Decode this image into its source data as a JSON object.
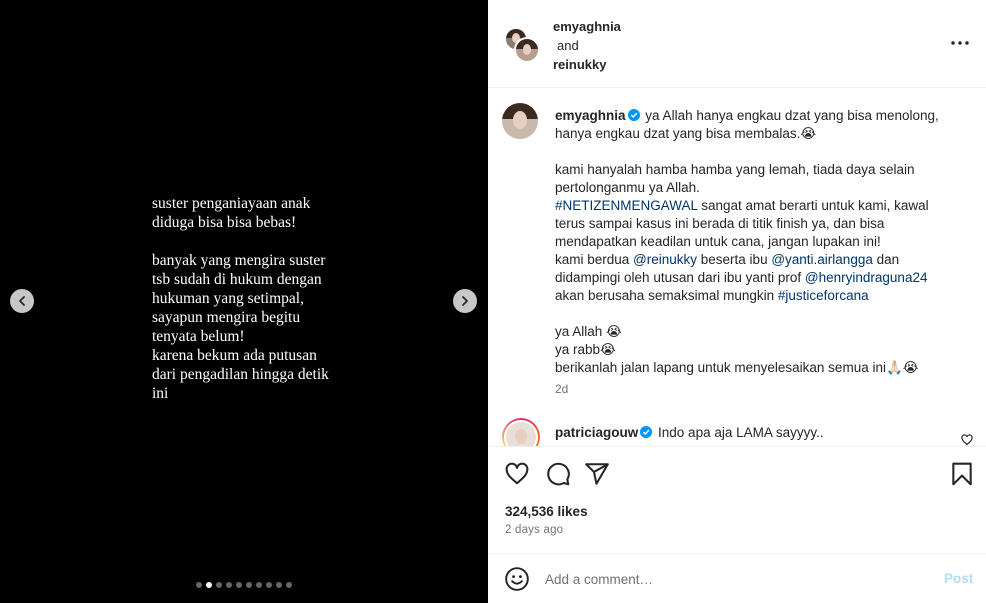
{
  "media": {
    "slide_paragraphs": [
      [
        "suster penganiayaan anak",
        "diduga bisa bisa bebas!"
      ],
      [
        "banyak yang mengira suster",
        "tsb sudah di hukum dengan",
        "hukuman yang setimpal,",
        "sayapun mengira begitu",
        "tenyata belum!",
        "karena bekum ada putusan",
        "dari pengadilan hingga detik",
        "ini"
      ]
    ],
    "slide_count": 10,
    "active_slide": 2,
    "prev_icon": "chevron-left-icon",
    "next_icon": "chevron-right-icon"
  },
  "header": {
    "author1": "emyaghnia",
    "and_label": "and",
    "author2": "reinukky",
    "more_icon": "more-horizontal-icon"
  },
  "caption": {
    "username": "emyaghnia",
    "verified_color": "#0095f6",
    "lines": [
      {
        "parts": [
          {
            "t": "ya Allah hanya engkau dzat yang bisa menolong,"
          }
        ]
      },
      {
        "parts": [
          {
            "t": "hanya engkau dzat yang bisa membalas.😭"
          }
        ]
      },
      {
        "gap": true
      },
      {
        "parts": [
          {
            "t": "kami hanyalah hamba hamba yang lemah, tiada daya selain"
          }
        ]
      },
      {
        "parts": [
          {
            "t": "pertolonganmu ya Allah."
          }
        ]
      },
      {
        "parts": [
          {
            "t": "#NETIZENMENGAWAL",
            "link": true
          },
          {
            "t": " sangat amat berarti untuk kami, kawal"
          }
        ]
      },
      {
        "parts": [
          {
            "t": "terus sampai kasus ini berada di titik finish ya, dan bisa"
          }
        ]
      },
      {
        "parts": [
          {
            "t": "mendapatkan keadilan untuk cana, jangan lupakan ini!"
          }
        ]
      },
      {
        "parts": [
          {
            "t": "kami berdua "
          },
          {
            "t": "@reinukky",
            "link": true
          },
          {
            "t": " beserta ibu "
          },
          {
            "t": "@yanti.airlangga",
            "link": true
          },
          {
            "t": " dan"
          }
        ]
      },
      {
        "parts": [
          {
            "t": "didampingi oleh utusan dari ibu yanti prof "
          },
          {
            "t": "@henryindraguna24",
            "link": true
          }
        ]
      },
      {
        "parts": [
          {
            "t": "akan berusaha semaksimal mungkin "
          },
          {
            "t": "#justiceforcana",
            "link": true
          }
        ]
      },
      {
        "gap": true
      },
      {
        "parts": [
          {
            "t": "ya Allah 😭"
          }
        ]
      },
      {
        "parts": [
          {
            "t": "ya rabb😭"
          }
        ]
      },
      {
        "parts": [
          {
            "t": "berikanlah jalan lapang untuk menyelesaikan semua ini🙏🏻😭"
          }
        ]
      }
    ],
    "time": "2d"
  },
  "comment": {
    "username": "patriciagouw",
    "text": "Indo apa aja LAMA sayyyy..",
    "like_icon": "heart-outline-icon"
  },
  "actions": {
    "like_icon": "heart-icon",
    "comment_icon": "comment-icon",
    "share_icon": "share-icon",
    "save_icon": "bookmark-icon",
    "likes": "324,536 likes",
    "ago": "2 days ago"
  },
  "add_comment": {
    "emoji_icon": "emoji-icon",
    "placeholder": "Add a comment…",
    "post_label": "Post"
  }
}
